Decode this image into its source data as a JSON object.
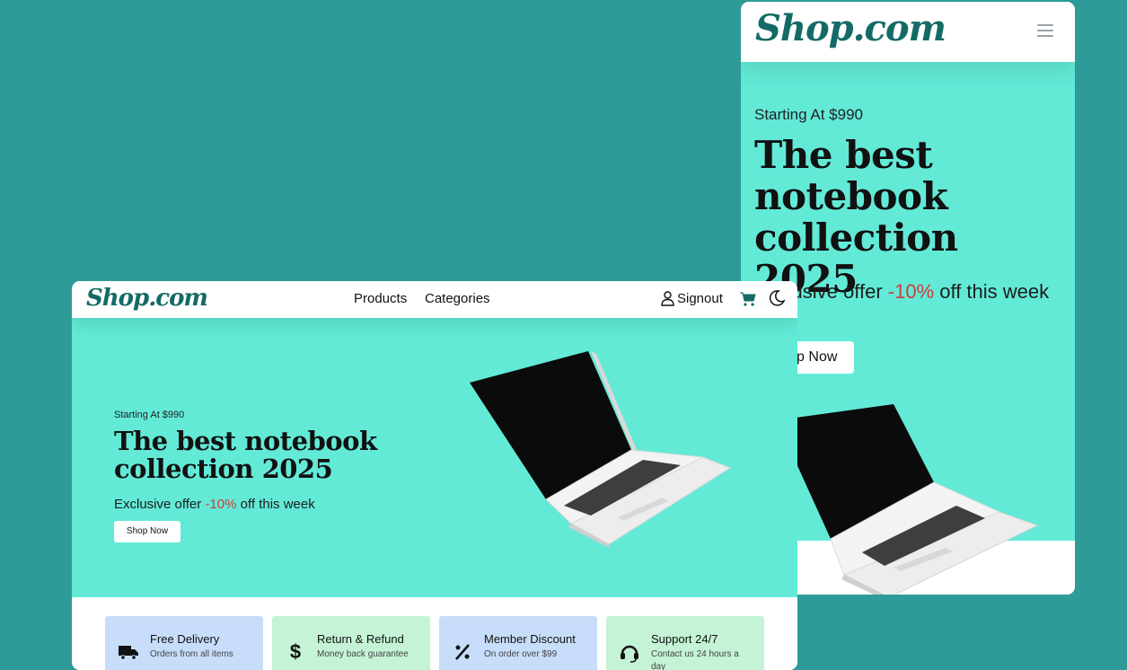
{
  "colors": {
    "background": "#2e9b98",
    "hero": "#62ead7",
    "brand": "#146b66",
    "offer_highlight": "#d23a3a",
    "feature_blue": "#c7ddfa",
    "feature_green": "#c4f3d5"
  },
  "mobile": {
    "logo": "Shop.com",
    "menu_icon": "hamburger-icon",
    "hero": {
      "starting": "Starting At $990",
      "title": "The best notebook collection 2025",
      "offer_pre": "Exclusive offer ",
      "offer_pct": "-10%",
      "offer_post": " off this week",
      "button": "Shop Now"
    }
  },
  "desktop": {
    "logo": "Shop.com",
    "nav": {
      "products": "Products",
      "categories": "Categories",
      "signout": "Signout",
      "user_icon": "user-icon",
      "cart_icon": "cart-icon",
      "theme_icon": "moon-icon"
    },
    "hero": {
      "starting": "Starting At $990",
      "title": "The best notebook collection 2025",
      "offer_pre": "Exclusive offer ",
      "offer_pct": "-10%",
      "offer_post": " off this week",
      "button": "Shop Now"
    },
    "features": [
      {
        "title": "Free Delivery",
        "subtitle": "Orders from all items",
        "icon": "truck-icon"
      },
      {
        "title": "Return & Refund",
        "subtitle": "Money back guarantee",
        "icon": "dollar-icon"
      },
      {
        "title": "Member Discount",
        "subtitle": "On order over $99",
        "icon": "percent-icon"
      },
      {
        "title": "Support 24/7",
        "subtitle": "Contact us 24 hours a day",
        "icon": "headset-icon"
      }
    ]
  }
}
